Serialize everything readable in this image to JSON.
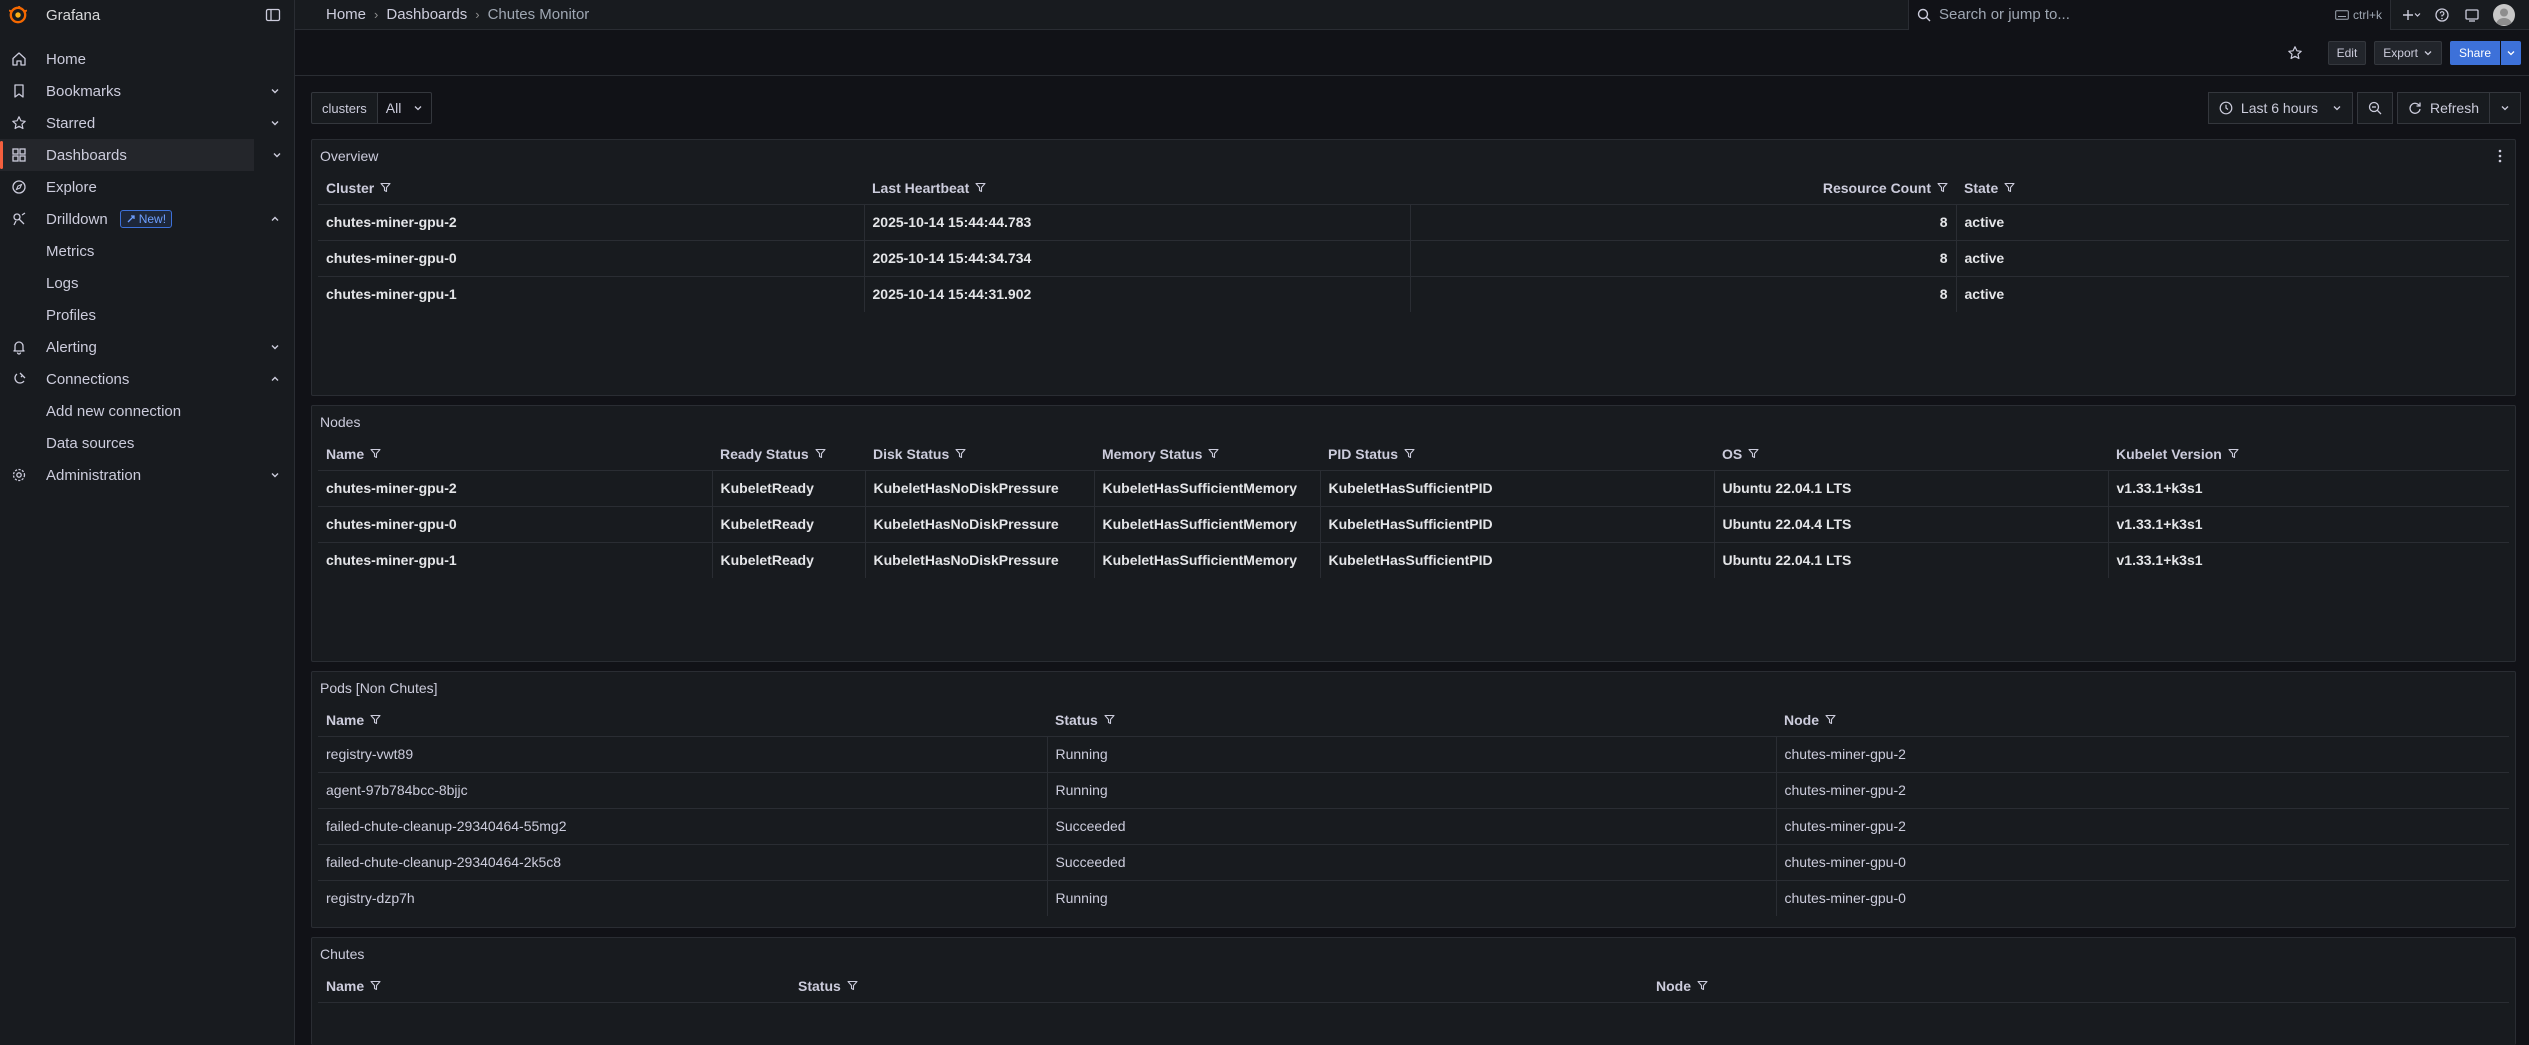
{
  "app": {
    "name": "Grafana"
  },
  "sidebar": {
    "items": [
      {
        "label": "Home",
        "icon": "home-icon"
      },
      {
        "label": "Bookmarks",
        "icon": "bookmark-icon"
      },
      {
        "label": "Starred",
        "icon": "star-icon"
      },
      {
        "label": "Dashboards",
        "icon": "dashboards-icon"
      },
      {
        "label": "Explore",
        "icon": "compass-icon"
      },
      {
        "label": "Drilldown",
        "icon": "drilldown-icon",
        "badge": "New!"
      },
      {
        "label": "Metrics"
      },
      {
        "label": "Logs"
      },
      {
        "label": "Profiles"
      },
      {
        "label": "Alerting",
        "icon": "bell-icon"
      },
      {
        "label": "Connections",
        "icon": "plug-icon"
      },
      {
        "label": "Add new connection"
      },
      {
        "label": "Data sources"
      },
      {
        "label": "Administration",
        "icon": "gear-icon"
      }
    ]
  },
  "breadcrumb": [
    "Home",
    "Dashboards",
    "Chutes Monitor"
  ],
  "search": {
    "placeholder": "Search or jump to...",
    "shortcut": "ctrl+k"
  },
  "toolbar": {
    "edit_label": "Edit",
    "export_label": "Export",
    "share_label": "Share"
  },
  "variables": {
    "label": "clusters",
    "value": "All"
  },
  "time": {
    "range_label": "Last 6 hours",
    "refresh_label": "Refresh"
  },
  "overview": {
    "title": "Overview",
    "columns": [
      "Cluster",
      "Last Heartbeat",
      "Resource Count",
      "State"
    ],
    "rows": [
      [
        "chutes-miner-gpu-2",
        "2025-10-14 15:44:44.783",
        "8",
        "active"
      ],
      [
        "chutes-miner-gpu-0",
        "2025-10-14 15:44:34.734",
        "8",
        "active"
      ],
      [
        "chutes-miner-gpu-1",
        "2025-10-14 15:44:31.902",
        "8",
        "active"
      ]
    ]
  },
  "nodes": {
    "title": "Nodes",
    "columns": [
      "Name",
      "Ready Status",
      "Disk Status",
      "Memory Status",
      "PID Status",
      "OS",
      "Kubelet Version"
    ],
    "rows": [
      [
        "chutes-miner-gpu-2",
        "KubeletReady",
        "KubeletHasNoDiskPressure",
        "KubeletHasSufficientMemory",
        "KubeletHasSufficientPID",
        "Ubuntu 22.04.1 LTS",
        "v1.33.1+k3s1"
      ],
      [
        "chutes-miner-gpu-0",
        "KubeletReady",
        "KubeletHasNoDiskPressure",
        "KubeletHasSufficientMemory",
        "KubeletHasSufficientPID",
        "Ubuntu 22.04.4 LTS",
        "v1.33.1+k3s1"
      ],
      [
        "chutes-miner-gpu-1",
        "KubeletReady",
        "KubeletHasNoDiskPressure",
        "KubeletHasSufficientMemory",
        "KubeletHasSufficientPID",
        "Ubuntu 22.04.1 LTS",
        "v1.33.1+k3s1"
      ]
    ]
  },
  "pods": {
    "title": "Pods [Non Chutes]",
    "columns": [
      "Name",
      "Status",
      "Node"
    ],
    "rows": [
      [
        "registry-vwt89",
        "Running",
        "chutes-miner-gpu-2"
      ],
      [
        "agent-97b784bcc-8bjjc",
        "Running",
        "chutes-miner-gpu-2"
      ],
      [
        "failed-chute-cleanup-29340464-55mg2",
        "Succeeded",
        "chutes-miner-gpu-2"
      ],
      [
        "failed-chute-cleanup-29340464-2k5c8",
        "Succeeded",
        "chutes-miner-gpu-0"
      ],
      [
        "registry-dzp7h",
        "Running",
        "chutes-miner-gpu-0"
      ]
    ]
  },
  "chutes": {
    "title": "Chutes",
    "columns": [
      "Name",
      "Status",
      "Node"
    ]
  }
}
